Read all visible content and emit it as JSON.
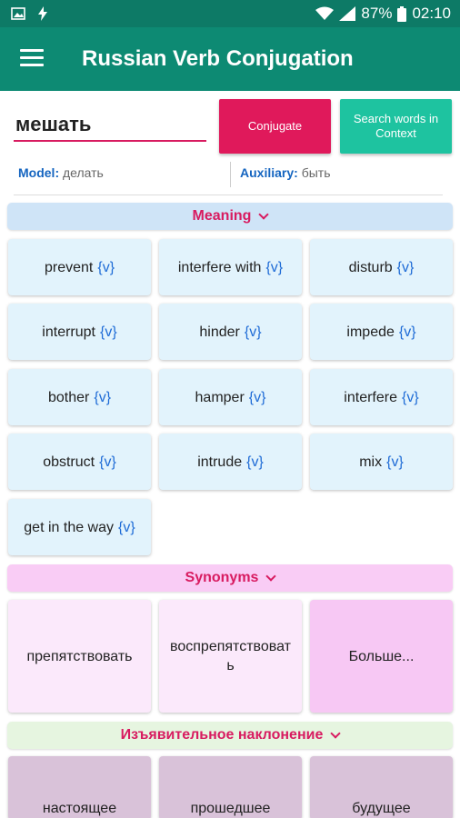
{
  "status_bar": {
    "battery": "87%",
    "time": "02:10"
  },
  "app_bar": {
    "title": "Russian Verb Conjugation"
  },
  "search": {
    "value": "мешать",
    "conjugate_label": "Conjugate",
    "context_label": "Search words in Context"
  },
  "info": {
    "model_label": "Model:",
    "model_value": "делать",
    "auxiliary_label": "Auxiliary:",
    "auxiliary_value": "быть"
  },
  "meaning": {
    "header": "Meaning",
    "tag": "{v}",
    "items": [
      {
        "word": "prevent"
      },
      {
        "word": "interfere with"
      },
      {
        "word": "disturb"
      },
      {
        "word": "interrupt"
      },
      {
        "word": "hinder"
      },
      {
        "word": "impede"
      },
      {
        "word": "bother"
      },
      {
        "word": "hamper"
      },
      {
        "word": "interfere"
      },
      {
        "word": "obstruct"
      },
      {
        "word": "intrude"
      },
      {
        "word": "mix"
      },
      {
        "word": "get in the way"
      }
    ]
  },
  "synonyms": {
    "header": "Synonyms",
    "items": [
      "препятствовать",
      "воспрепятствовать",
      "Больше..."
    ]
  },
  "indicative": {
    "header": "Изъявительное наклонение",
    "tenses": [
      "настоящее",
      "прошедшее",
      "будущее"
    ]
  },
  "colors": {
    "app_bar": "#0d8a73",
    "status_bar": "#0d7a66",
    "accent": "#e0195b",
    "secondary_button": "#1ec3a0",
    "meaning_section": "#cfe4f7",
    "synonym_section": "#f9ccf5",
    "indicative_section": "#e6f5e0"
  }
}
